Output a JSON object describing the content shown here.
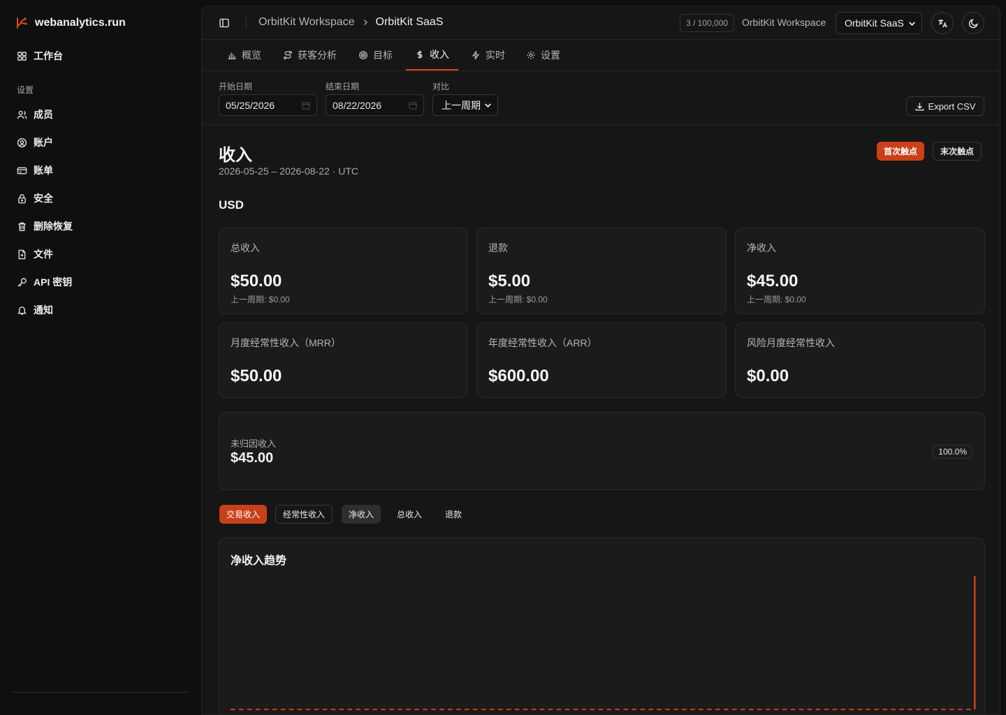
{
  "brand": {
    "name": "webanalytics.run",
    "accent": "#e0481c"
  },
  "sidebar": {
    "dashboard": "工作台",
    "section_title": "设置",
    "items": [
      {
        "label": "成员",
        "icon": "users-icon"
      },
      {
        "label": "账户",
        "icon": "user-circle-icon"
      },
      {
        "label": "账单",
        "icon": "credit-card-icon"
      },
      {
        "label": "安全",
        "icon": "lock-icon"
      },
      {
        "label": "删除恢复",
        "icon": "trash-icon"
      },
      {
        "label": "文件",
        "icon": "file-icon"
      },
      {
        "label": "API 密钥",
        "icon": "key-icon"
      },
      {
        "label": "通知",
        "icon": "bell-icon"
      }
    ]
  },
  "topbar": {
    "breadcrumb_workspace": "OrbitKit Workspace",
    "breadcrumb_project": "OrbitKit SaaS",
    "usage": "3 / 100,000",
    "workspace_name": "OrbitKit Workspace",
    "project_select": "OrbitKit SaaS"
  },
  "tabs": [
    {
      "label": "概览",
      "icon": "bar-chart-icon"
    },
    {
      "label": "获客分析",
      "icon": "route-icon"
    },
    {
      "label": "目标",
      "icon": "target-icon"
    },
    {
      "label": "收入",
      "icon": "dollar-icon",
      "active": true
    },
    {
      "label": "实时",
      "icon": "bolt-icon"
    },
    {
      "label": "设置",
      "icon": "gear-icon"
    }
  ],
  "filters": {
    "start_label": "开始日期",
    "start_value": "05/25/2026",
    "end_label": "结束日期",
    "end_value": "08/22/2026",
    "compare_label": "对比",
    "compare_value": "上一周期",
    "export_label": "Export CSV"
  },
  "page": {
    "title": "收入",
    "subtitle": "2026-05-25 – 2026-08-22 · UTC",
    "first_touch": "首次触点",
    "last_touch": "末次触点",
    "currency": "USD"
  },
  "metrics": [
    {
      "label": "总收入",
      "value": "$50.00",
      "prev": "上一周期: $0.00"
    },
    {
      "label": "退款",
      "value": "$5.00",
      "prev": "上一周期: $0.00"
    },
    {
      "label": "净收入",
      "value": "$45.00",
      "prev": "上一周期: $0.00"
    },
    {
      "label": "月度经常性收入（MRR）",
      "value": "$50.00"
    },
    {
      "label": "年度经常性收入（ARR）",
      "value": "$600.00"
    },
    {
      "label": "风险月度经常性收入",
      "value": "$0.00"
    }
  ],
  "unattributed": {
    "label": "未归因收入",
    "value": "$45.00",
    "percent": "100.0%"
  },
  "segments": [
    "交易收入",
    "经常性收入",
    "净收入",
    "总收入",
    "退款"
  ],
  "chart_data": {
    "type": "bar",
    "title": "净收入趋势",
    "xlabel": "",
    "ylabel": "",
    "x_start": "2026-05-25",
    "x_end": "2026-08-22",
    "series": [
      {
        "values_zero_days": 89,
        "last_value": 45
      }
    ],
    "note_values": "daily net revenue: all days 0 except final day 45",
    "color": "#c9401a"
  }
}
